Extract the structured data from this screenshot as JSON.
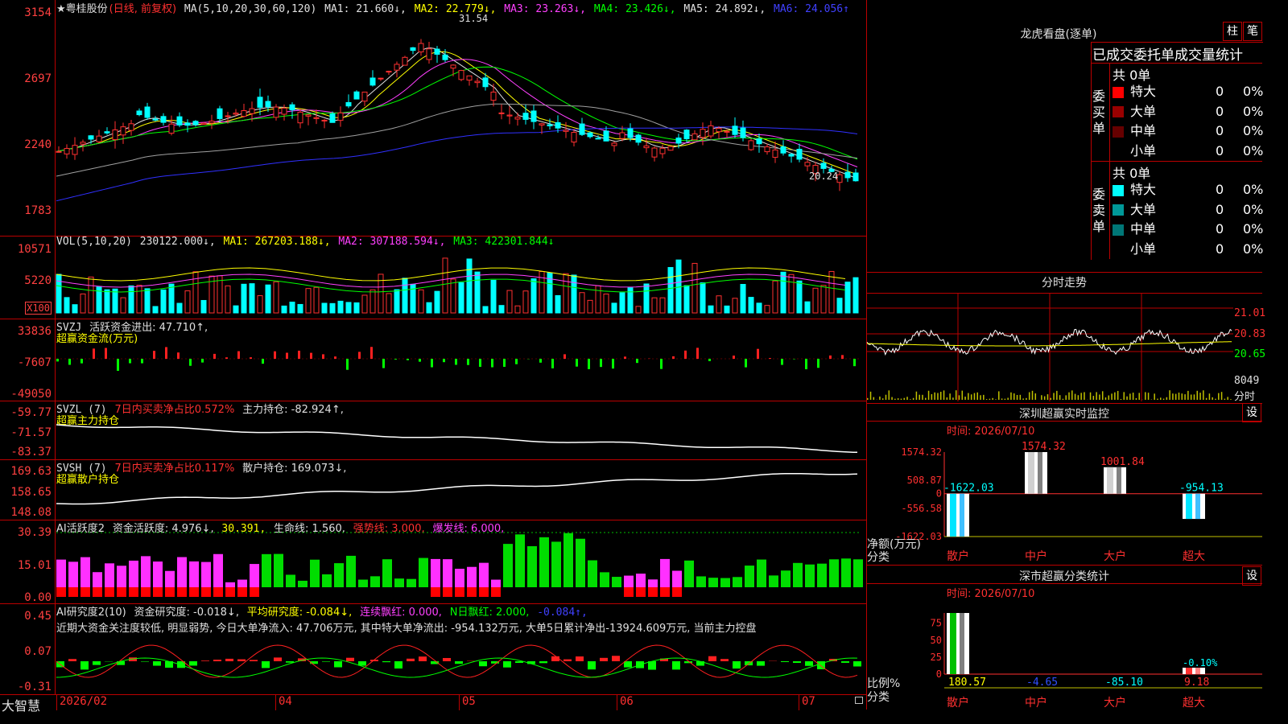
{
  "header": {
    "stock": "★粤桂股份",
    "mode": "(日线, 前复权)",
    "ma_label": "MA(5,10,20,30,60,120)",
    "ma1": "MA1: 21.660↓,",
    "ma2": "MA2: 22.779↓,",
    "ma3": "MA3: 23.263↓,",
    "ma4": "MA4: 23.426↓,",
    "ma5": "MA5: 24.892↓,",
    "ma6": "MA6: 24.056↑"
  },
  "price_axis": [
    "3154",
    "2697",
    "2240",
    "1783"
  ],
  "price_annotations": {
    "high": "31.54",
    "low": "20.24"
  },
  "vol": {
    "label": "VOL(5,10,20)",
    "value": "230122.000↓,",
    "ma1": "MA1: 267203.188↓,",
    "ma2": "MA2: 307188.594↓,",
    "ma3": "MA3: 422301.844↓",
    "axis": [
      "10571",
      "5220",
      "X100"
    ]
  },
  "svzj": {
    "label": "SVZJ",
    "desc": "活跃资金进出: 47.710↑,",
    "sub": "超赢资金流(万元)",
    "axis": [
      "33836",
      "-7607",
      "-49050"
    ]
  },
  "svzl": {
    "label": "SVZL (7)",
    "ratio": "7日内买卖净占比0.572%",
    "hold": "主力持仓: -82.924↑,",
    "sub": "超赢主力持仓",
    "axis": [
      "-59.77",
      "-71.57",
      "-83.37"
    ]
  },
  "svsh": {
    "label": "SVSH (7)",
    "ratio": "7日内买卖净占比0.117%",
    "hold": "散户持仓: 169.073↓,",
    "sub": "超赢散户持仓",
    "axis": [
      "169.63",
      "158.65",
      "148.08"
    ]
  },
  "ai1": {
    "label": "AI活跃度2",
    "a": "资金活跃度: 4.976↓,",
    "b": "30.391,",
    "c": "生命线: 1.560,",
    "d": "强势线: 3.000,",
    "e": "爆发线: 6.000,",
    "axis": [
      "30.39",
      "15.01",
      "0.00"
    ]
  },
  "ai2": {
    "label": "AI研究度2(10)",
    "a": "资金研究度: -0.018↓,",
    "b": "平均研究度: -0.084↓,",
    "c": "连续飘红: 0.000,",
    "d": "N日飘红: 2.000,",
    "e": "-0.084↑,",
    "summary": "近期大资金关注度较低, 明显弱势, 今日大单净流入: 47.706万元, 其中特大单净流出: -954.132万元, 大单5日累计净出-13924.609万元, 当前主力控盘",
    "axis": [
      "0.45",
      "0.07",
      "-0.31"
    ]
  },
  "xaxis": [
    "2026/02",
    "04",
    "05",
    "06",
    "07"
  ],
  "footer": {
    "brand": "大智慧"
  },
  "lhb": {
    "title": "龙虎看盘(逐单)",
    "btn1": "柱",
    "btn2": "笔",
    "sub": "已成交委托单成交量统计",
    "buy_label": "委买单",
    "sell_label": "委卖单",
    "buy_total": "共 0单",
    "sell_total": "共 0单",
    "buy_rows": [
      {
        "name": "特大",
        "n": "0",
        "p": "0%",
        "color": "#ff0000"
      },
      {
        "name": "大单",
        "n": "0",
        "p": "0%",
        "color": "#990000"
      },
      {
        "name": "中单",
        "n": "0",
        "p": "0%",
        "color": "#660000"
      },
      {
        "name": "小单",
        "n": "0",
        "p": "0%",
        "color": "#000000"
      }
    ],
    "sell_rows": [
      {
        "name": "特大",
        "n": "0",
        "p": "0%",
        "color": "#00ffff"
      },
      {
        "name": "大单",
        "n": "0",
        "p": "0%",
        "color": "#009999"
      },
      {
        "name": "中单",
        "n": "0",
        "p": "0%",
        "color": "#007777"
      },
      {
        "name": "小单",
        "n": "0",
        "p": "0%",
        "color": "#000000"
      }
    ]
  },
  "intraday": {
    "title": "分时走势",
    "axis": [
      "21.01",
      "20.83",
      "20.65"
    ],
    "vol": "8049",
    "vol_label": "分时"
  },
  "monitor": {
    "title": "深圳超赢实时监控",
    "btn": "设",
    "time": "时间: 2026/07/10",
    "axis": [
      "1574.32",
      "508.87",
      "0",
      "-556.58",
      "-1622.03"
    ],
    "ylabel": "净额(万元)",
    "xlabel": "分类",
    "categories": [
      "散户",
      "中户",
      "大户",
      "超大"
    ],
    "values": [
      -1622.03,
      1574.32,
      1001.84,
      -954.13
    ],
    "value_labels": [
      "-1622.03",
      "1574.32",
      "1001.84",
      "-954.13"
    ]
  },
  "classify": {
    "title": "深市超赢分类统计",
    "btn": "设",
    "time": "时间: 2026/07/10",
    "axis": [
      "75",
      "50",
      "25",
      "0"
    ],
    "ylabel": "比例%",
    "xlabel": "分类",
    "categories": [
      "散户",
      "中户",
      "大户",
      "超大"
    ],
    "values": [
      180.57,
      -4.65,
      -85.1,
      9.18
    ],
    "value_labels": [
      "180.57",
      "-4.65",
      "-85.10",
      "9.18"
    ],
    "extra": "-0.10%"
  },
  "chart_data": [
    {
      "type": "candlestick",
      "title": "粤桂股份 (日线, 前复权)",
      "ylim": [
        17.83,
        31.54
      ],
      "x": [
        "2026/02",
        "04",
        "05",
        "06",
        "07"
      ],
      "series": [
        {
          "name": "MA1",
          "values": [
            21.66
          ]
        },
        {
          "name": "MA2",
          "values": [
            22.779
          ]
        },
        {
          "name": "MA3",
          "values": [
            23.263
          ]
        },
        {
          "name": "MA4",
          "values": [
            23.426
          ]
        },
        {
          "name": "MA5",
          "values": [
            24.892
          ]
        },
        {
          "name": "MA6",
          "values": [
            24.056
          ]
        }
      ]
    },
    {
      "type": "bar",
      "title": "深圳超赢实时监控",
      "categories": [
        "散户",
        "中户",
        "大户",
        "超大"
      ],
      "values": [
        -1622.03,
        1574.32,
        1001.84,
        -954.13
      ],
      "ylabel": "净额(万元)",
      "ylim": [
        -1622.03,
        1574.32
      ]
    },
    {
      "type": "bar",
      "title": "深市超赢分类统计",
      "categories": [
        "散户",
        "中户",
        "大户",
        "超大"
      ],
      "values": [
        180.57,
        -4.65,
        -85.1,
        9.18
      ],
      "ylabel": "比例%",
      "ylim": [
        0,
        75
      ]
    }
  ]
}
